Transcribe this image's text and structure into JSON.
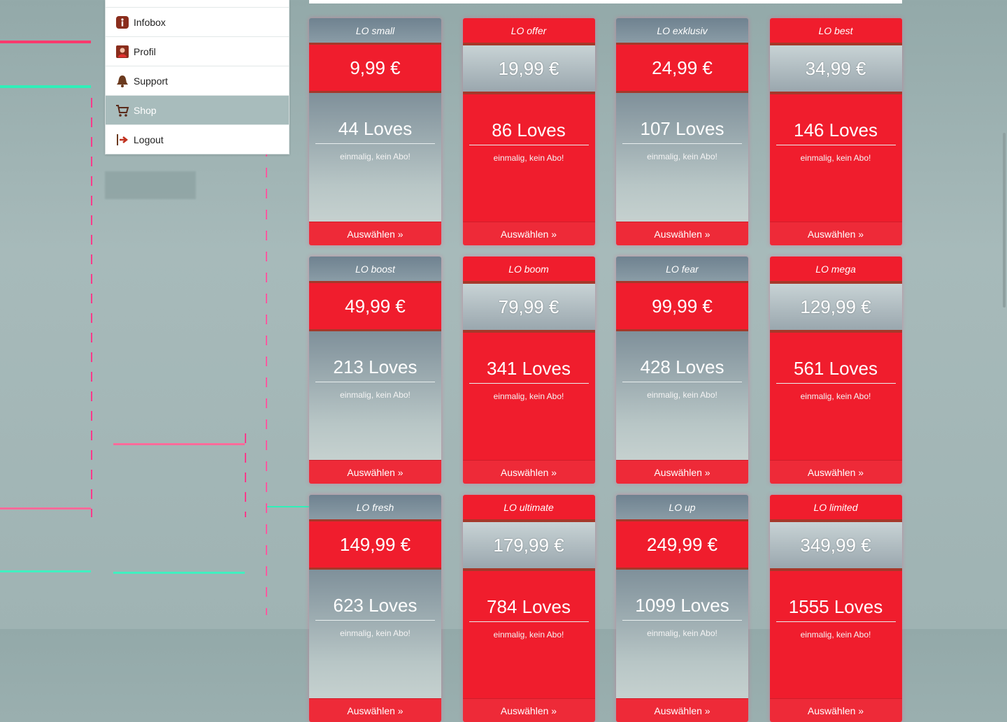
{
  "menu": {
    "items": [
      {
        "label": "Infobox",
        "icon": "info-icon"
      },
      {
        "label": "Profil",
        "icon": "profile-icon"
      },
      {
        "label": "Support",
        "icon": "bell-icon"
      },
      {
        "label": "Shop",
        "icon": "cart-icon",
        "active": true
      },
      {
        "label": "Logout",
        "icon": "logout-icon"
      }
    ]
  },
  "shop": {
    "note": "einmalig, kein Abo!",
    "button_label": "Auswählen »",
    "cards": [
      {
        "name": "LO small",
        "price": "9,99 €",
        "loves": "44 Loves",
        "style": "grey"
      },
      {
        "name": "LO offer",
        "price": "19,99 €",
        "loves": "86 Loves",
        "style": "red"
      },
      {
        "name": "LO exklusiv",
        "price": "24,99 €",
        "loves": "107 Loves",
        "style": "grey"
      },
      {
        "name": "LO best",
        "price": "34,99 €",
        "loves": "146 Loves",
        "style": "red"
      },
      {
        "name": "LO boost",
        "price": "49,99 €",
        "loves": "213 Loves",
        "style": "grey"
      },
      {
        "name": "LO boom",
        "price": "79,99 €",
        "loves": "341 Loves",
        "style": "red"
      },
      {
        "name": "LO fear",
        "price": "99,99 €",
        "loves": "428 Loves",
        "style": "grey"
      },
      {
        "name": "LO mega",
        "price": "129,99 €",
        "loves": "561 Loves",
        "style": "red"
      },
      {
        "name": "LO fresh",
        "price": "149,99 €",
        "loves": "623 Loves",
        "style": "grey"
      },
      {
        "name": "LO ultimate",
        "price": "179,99 €",
        "loves": "784 Loves",
        "style": "red"
      },
      {
        "name": "LO up",
        "price": "249,99 €",
        "loves": "1099 Loves",
        "style": "grey"
      },
      {
        "name": "LO limited",
        "price": "349,99 €",
        "loves": "1555 Loves",
        "style": "red"
      }
    ]
  },
  "colors": {
    "accent_red": "#f01d2d",
    "background": "#a7baba"
  }
}
